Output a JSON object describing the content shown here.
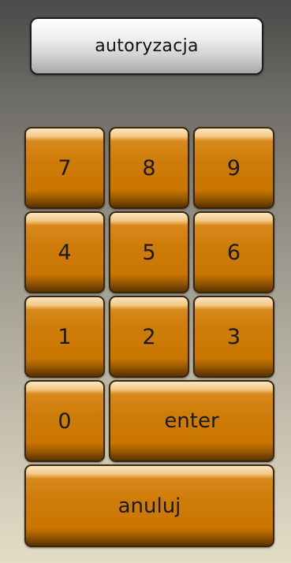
{
  "header": {
    "title": "autoryzacja"
  },
  "keypad": {
    "k7": "7",
    "k8": "8",
    "k9": "9",
    "k4": "4",
    "k5": "5",
    "k6": "6",
    "k1": "1",
    "k2": "2",
    "k3": "3",
    "k0": "0",
    "enter": "enter",
    "cancel": "anuluj"
  },
  "colors": {
    "key_fill": "#c97500",
    "key_border": "#3a2608",
    "title_fill": "#e0e0e0"
  }
}
